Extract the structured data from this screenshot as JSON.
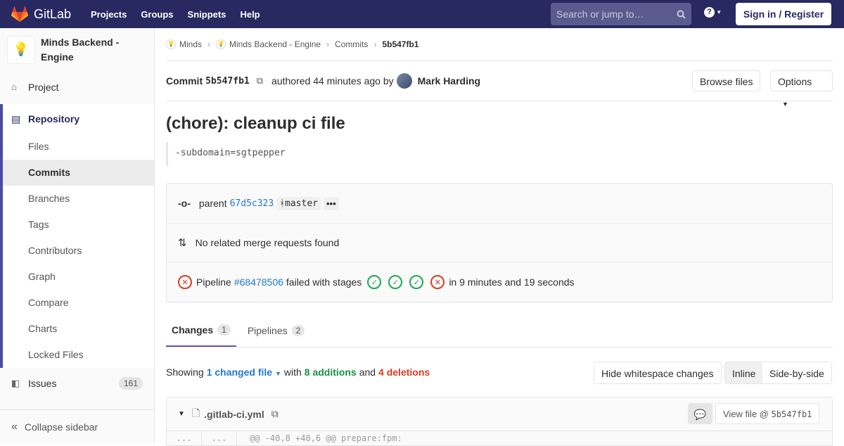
{
  "topbar": {
    "brand": "GitLab",
    "links": [
      "Projects",
      "Groups",
      "Snippets",
      "Help"
    ],
    "search_placeholder": "Search or jump to…",
    "signin": "Sign in / Register"
  },
  "sidebar": {
    "project_name": "Minds Backend - Engine",
    "project": "Project",
    "repository": "Repository",
    "repo_items": [
      "Files",
      "Commits",
      "Branches",
      "Tags",
      "Contributors",
      "Graph",
      "Compare",
      "Charts",
      "Locked Files"
    ],
    "issues": "Issues",
    "issues_count": "161",
    "collapse": "Collapse sidebar"
  },
  "breadcrumb": {
    "group": "Minds",
    "project": "Minds Backend - Engine",
    "section": "Commits",
    "current": "5b547fb1"
  },
  "commit": {
    "label": "Commit",
    "sha": "5b547fb1",
    "authored": "authored 44 minutes ago by",
    "author": "Mark Harding",
    "browse_files": "Browse files",
    "options": "Options",
    "title": "(chore): cleanup ci file",
    "description": "-subdomain=sgtpepper",
    "parent_label": "parent",
    "parent_sha": "67d5c323",
    "branch": "master",
    "merge_requests": "No related merge requests found",
    "pipeline_label": "Pipeline",
    "pipeline_id": "#68478506",
    "pipeline_status": "failed with stages",
    "pipeline_duration": "in 9 minutes and 19 seconds"
  },
  "tabs": {
    "changes": "Changes",
    "changes_count": "1",
    "pipelines": "Pipelines",
    "pipelines_count": "2"
  },
  "summary": {
    "showing": "Showing",
    "changed": "1 changed file",
    "with": "with",
    "additions": "8 additions",
    "and": "and",
    "deletions": "4 deletions",
    "hide_whitespace": "Hide whitespace changes",
    "inline": "Inline",
    "side_by_side": "Side-by-side"
  },
  "file": {
    "name": ".gitlab-ci.yml",
    "view_file": "View file @",
    "view_sha": "5b547fb1",
    "hunk": "@@ -40,8 +40,6 @@ prepare:fpm:",
    "ellipsis": "..."
  }
}
